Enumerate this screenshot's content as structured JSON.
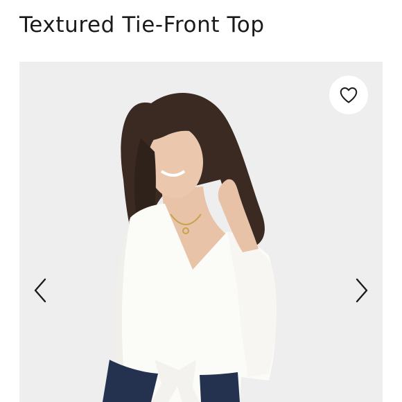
{
  "product": {
    "title": "Textured Tie-Front Top"
  },
  "gallery": {
    "favorite_icon": "heart-outline-icon",
    "prev_icon": "chevron-left-icon",
    "next_icon": "chevron-right-icon",
    "image_subject": "model-wearing-white-tie-front-top",
    "background_color": "#eeeeee",
    "icon_color": "#1a1a1a"
  }
}
